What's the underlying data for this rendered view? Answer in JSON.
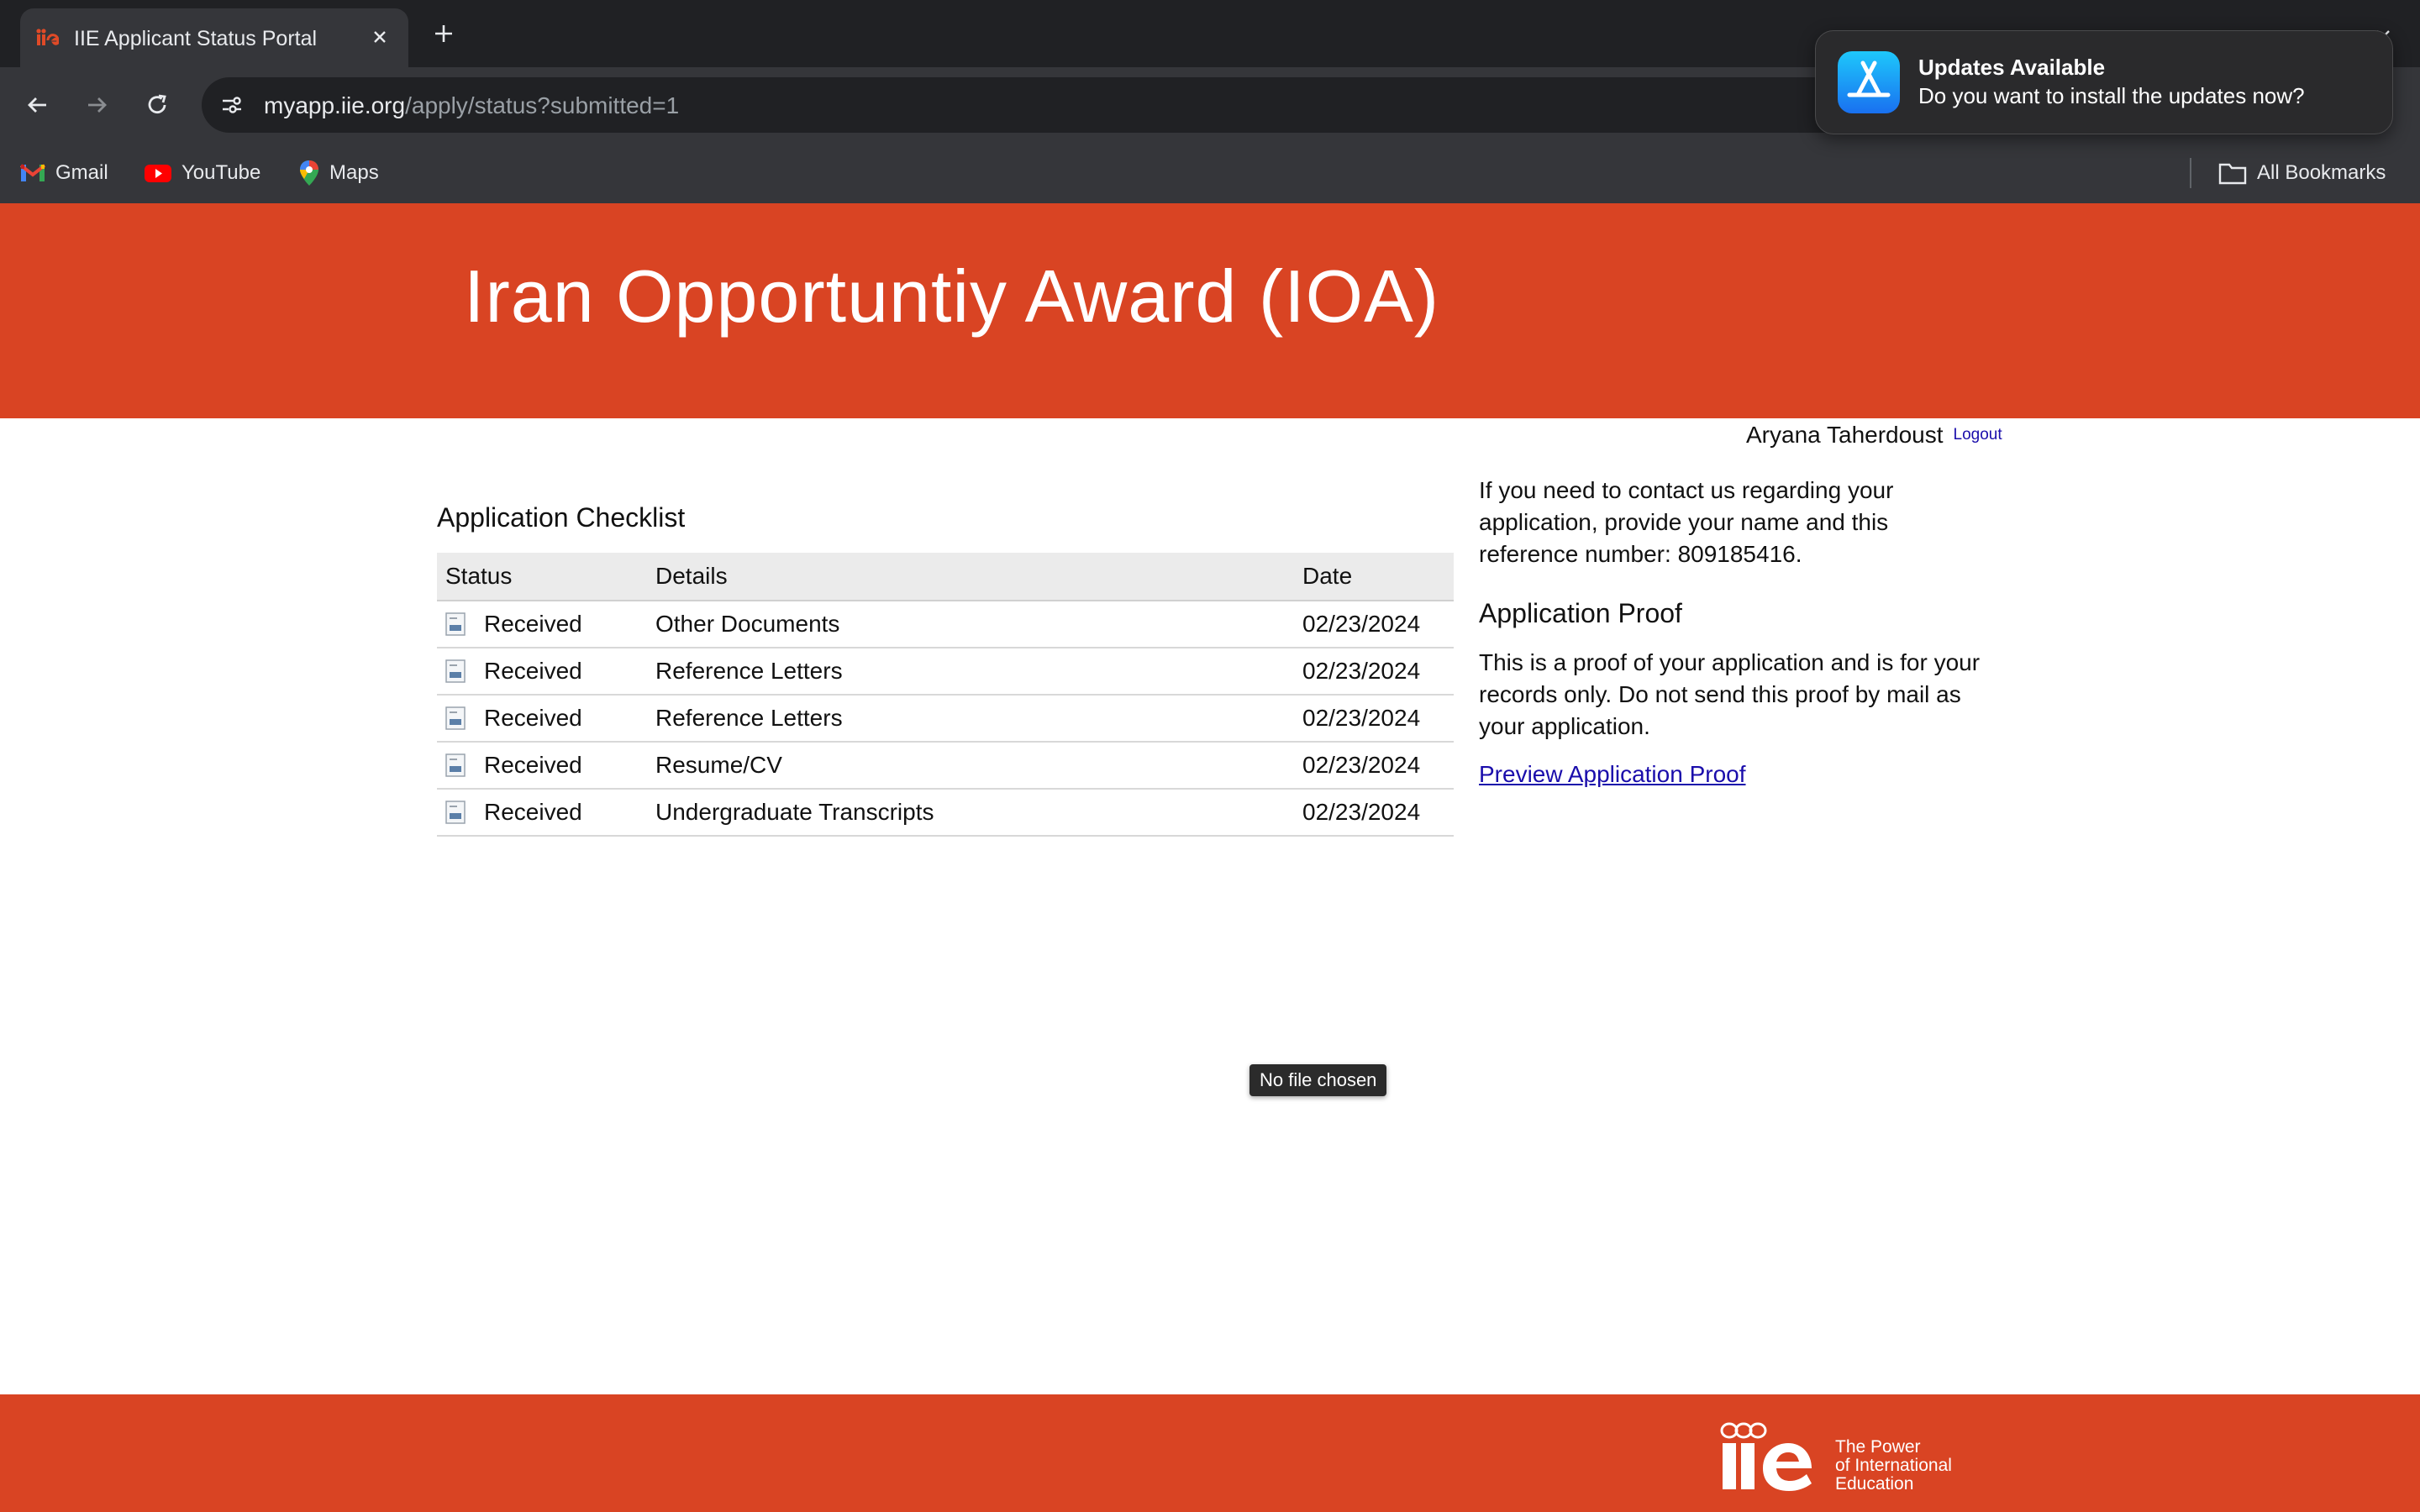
{
  "browser": {
    "tab": {
      "title": "IIE Applicant Status Portal"
    },
    "url": {
      "domain": "myapp.iie.org",
      "path": "/apply/status?submitted=1"
    },
    "bookmarks": [
      {
        "label": "Gmail",
        "icon": "gmail-icon"
      },
      {
        "label": "YouTube",
        "icon": "youtube-icon"
      },
      {
        "label": "Maps",
        "icon": "maps-icon"
      }
    ],
    "all_bookmarks_label": "All Bookmarks"
  },
  "notification": {
    "title": "Updates Available",
    "body": "Do you want to install the updates now?",
    "icon": "app-store-icon"
  },
  "page": {
    "banner_title": "Iran Opportuntiy Award (IOA)",
    "user_name": "Aryana Taherdoust",
    "logout_label": "Logout",
    "checklist": {
      "heading": "Application Checklist",
      "columns": [
        "Status",
        "Details",
        "Date"
      ],
      "rows": [
        {
          "status": "Received",
          "details": "Other Documents",
          "date": "02/23/2024"
        },
        {
          "status": "Received",
          "details": "Reference Letters",
          "date": "02/23/2024"
        },
        {
          "status": "Received",
          "details": "Reference Letters",
          "date": "02/23/2024"
        },
        {
          "status": "Received",
          "details": "Resume/CV",
          "date": "02/23/2024"
        },
        {
          "status": "Received",
          "details": "Undergraduate Transcripts",
          "date": "02/23/2024"
        }
      ]
    },
    "contact_text": "If you need to contact us regarding your application, provide your name and this reference number: 809185416.",
    "proof": {
      "heading": "Application Proof",
      "text": "This is a proof of your application and is for your records only. Do not send this proof by mail as your application.",
      "link_label": "Preview Application Proof"
    },
    "tooltip": "No file chosen",
    "footer": {
      "tagline": [
        "The Power",
        "of International",
        "Education"
      ]
    }
  },
  "colors": {
    "brand": "#d94423",
    "link": "#1a0dab",
    "chrome_dark": "#202124",
    "chrome": "#35363a"
  }
}
